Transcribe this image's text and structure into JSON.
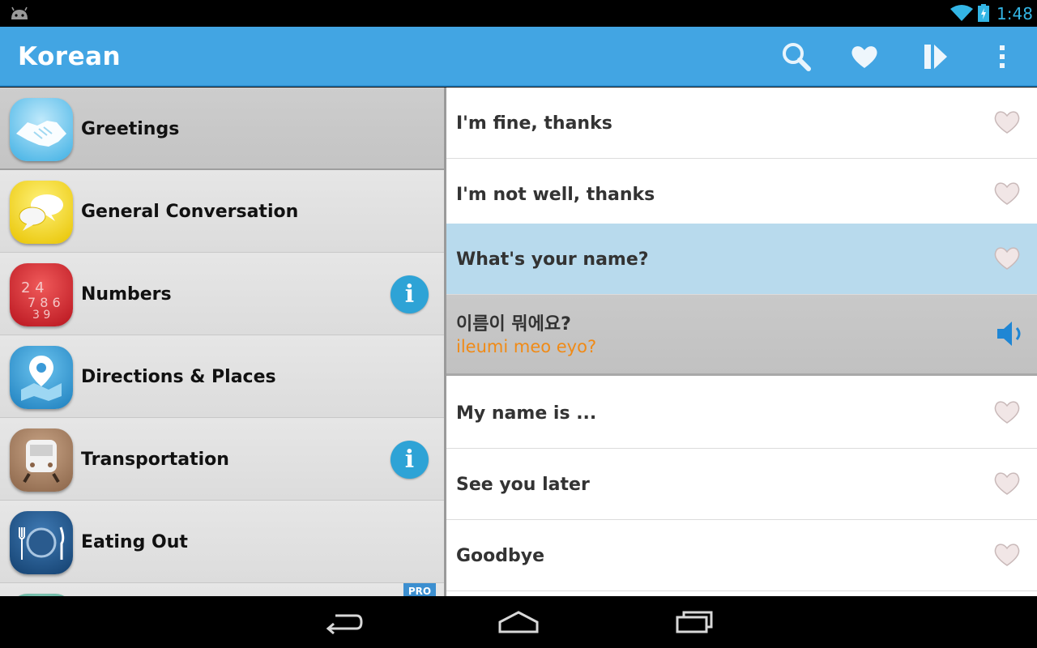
{
  "status_bar": {
    "time": "1:48",
    "icons": [
      "android-icon",
      "wifi-icon",
      "battery-charging-icon"
    ]
  },
  "action_bar": {
    "title": "Korean",
    "actions": [
      "search-icon",
      "heart-icon",
      "play-icon",
      "overflow-menu-icon"
    ]
  },
  "categories": [
    {
      "label": "Greetings",
      "icon": "handshake-icon",
      "selected": true,
      "info": false
    },
    {
      "label": "General Conversation",
      "icon": "speech-bubbles-icon",
      "selected": false,
      "info": false
    },
    {
      "label": "Numbers",
      "icon": "numbers-icon",
      "selected": false,
      "info": true
    },
    {
      "label": "Directions & Places",
      "icon": "map-pin-icon",
      "selected": false,
      "info": false
    },
    {
      "label": "Transportation",
      "icon": "train-icon",
      "selected": false,
      "info": true
    },
    {
      "label": "Eating Out",
      "icon": "plate-cutlery-icon",
      "selected": false,
      "info": false
    }
  ],
  "info_glyph": "i",
  "pro_tag": "PRO",
  "phrases": [
    {
      "text": "I'm fine, thanks"
    },
    {
      "text": "I'm not well, thanks"
    },
    {
      "text": "What's your name?",
      "active": true
    },
    {
      "text": "My name is ..."
    },
    {
      "text": "See you later"
    },
    {
      "text": "Goodbye"
    }
  ],
  "translation": {
    "korean": "이름이 뭐에요?",
    "romanization": "ileumi meo eyo?"
  },
  "colors": {
    "action_bar": "#42a5e3",
    "selected_phrase": "#b8daed",
    "romanization": "#f08a16",
    "accent": "#33b5e5"
  },
  "nav_bar": [
    "back-icon",
    "home-icon",
    "recent-apps-icon"
  ]
}
